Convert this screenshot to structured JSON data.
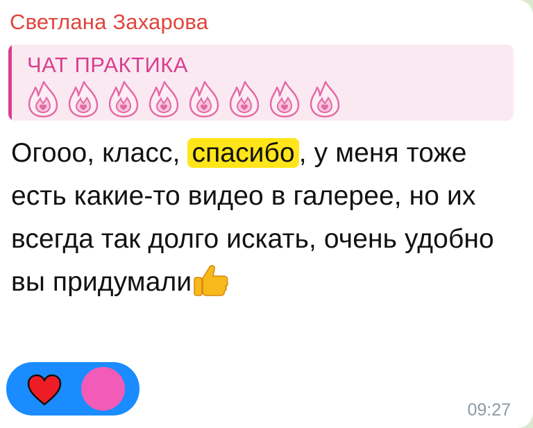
{
  "message": {
    "sender": "Светлана Захарова",
    "reply": {
      "title": "ЧАТ ПРАКТИКА",
      "icon": "flame-icon",
      "icon_count": 8,
      "accent_color": "#d83f8e"
    },
    "text": {
      "before": "Огооо, класс, ",
      "highlight": "спасибо",
      "after": ", у меня тоже есть какие-то видео в галерее, но их всегда так долго искать, очень удобно вы придумали",
      "highlight_color": "#ffe51a"
    },
    "emoji": "thumbs-up-icon",
    "time": "09:27",
    "reactions": {
      "emoji": "heart-icon",
      "background": "#1a8cff",
      "avatar_color": "#f25bb7"
    },
    "sender_color": "#e0443d"
  }
}
